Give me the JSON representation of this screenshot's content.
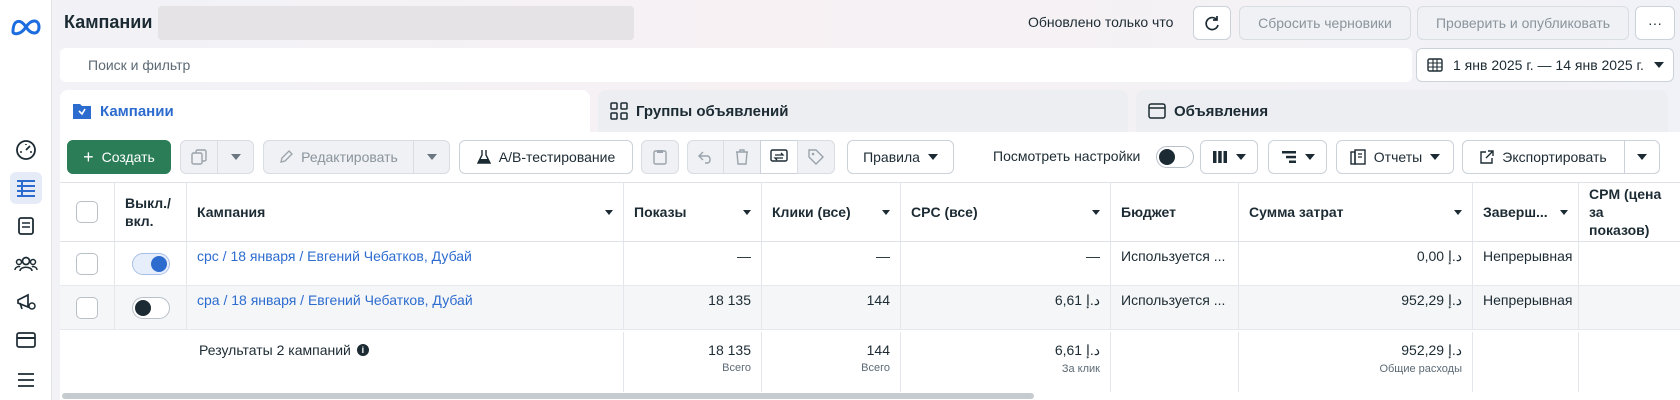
{
  "header": {
    "title": "Кампании",
    "updated": "Обновлено только что",
    "reset_drafts": "Сбросить черновики",
    "review_publish": "Проверить и опубликовать",
    "more": "···"
  },
  "search": {
    "placeholder": "Поиск и фильтр"
  },
  "date_range": "1 янв 2025 г. — 14 янв 2025 г.",
  "tabs": [
    {
      "label": "Кампании"
    },
    {
      "label": "Группы объявлений"
    },
    {
      "label": "Объявления"
    }
  ],
  "toolbar": {
    "create": "Создать",
    "edit": "Редактировать",
    "ab_test": "A/B-тестирование",
    "rules": "Правила",
    "view_settings": "Посмотреть настройки",
    "reports": "Отчеты",
    "export": "Экспортировать"
  },
  "table": {
    "headers": {
      "toggle": "Выкл./\nвкл.",
      "campaign": "Кампания",
      "impressions": "Показы",
      "clicks": "Клики (все)",
      "cpc": "CPC (все)",
      "budget": "Бюджет",
      "spend": "Сумма затрат",
      "ends": "Заверш...",
      "cpm": "CPM (цена за\nпоказов)"
    },
    "rows": [
      {
        "name": "cpc / 18 января / Евгений Чебатков, Дубай",
        "impressions": "—",
        "clicks": "—",
        "cpc": "—",
        "budget": "Используется ...",
        "spend": "0,00 د.إ",
        "ends": "Непрерывная",
        "on": true
      },
      {
        "name": "cpa / 18 января / Евгений Чебатков, Дубай",
        "impressions": "18 135",
        "clicks": "144",
        "cpc": "6,61 د.إ",
        "budget": "Используется ...",
        "spend": "952,29 د.إ",
        "ends": "Непрерывная",
        "on": false
      }
    ],
    "totals": {
      "label": "Результаты 2 кампаний",
      "impressions": "18 135",
      "impressions_sub": "Всего",
      "clicks": "144",
      "clicks_sub": "Всего",
      "cpc": "6,61 د.إ",
      "cpc_sub": "За клик",
      "spend": "952,29 د.إ",
      "spend_sub": "Общие расходы"
    }
  }
}
